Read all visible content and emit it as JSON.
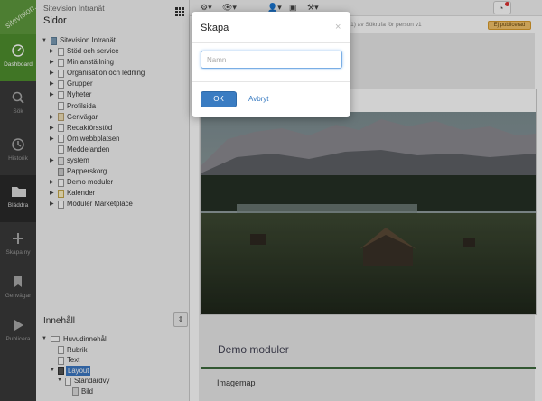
{
  "rail": {
    "logo": "sitevision.",
    "items": [
      {
        "label": "Dashboard",
        "icon": "gauge-icon"
      },
      {
        "label": "Sök",
        "icon": "search-icon"
      },
      {
        "label": "Historik",
        "icon": "history-icon"
      },
      {
        "label": "Bläddra",
        "icon": "folder-icon"
      },
      {
        "label": "Skapa ny",
        "icon": "plus-icon"
      },
      {
        "label": "Genvägar",
        "icon": "bookmark-icon"
      },
      {
        "label": "Publicera",
        "icon": "play-icon"
      }
    ]
  },
  "panel": {
    "site_name": "Sitevision Intranät",
    "section_title": "Sidor",
    "tree": [
      {
        "label": "Sitevision Intranät"
      },
      {
        "label": "Stöd och service"
      },
      {
        "label": "Min anställning"
      },
      {
        "label": "Organisation och ledning"
      },
      {
        "label": "Grupper"
      },
      {
        "label": "Nyheter"
      },
      {
        "label": "Profilsida"
      },
      {
        "label": "Genvägar"
      },
      {
        "label": "Redaktörsstöd"
      },
      {
        "label": "Om webbplatsen"
      },
      {
        "label": "Meddelanden"
      },
      {
        "label": "system"
      },
      {
        "label": "Papperskorg"
      },
      {
        "label": "Demo moduler"
      },
      {
        "label": "Kalender"
      },
      {
        "label": "Moduler Marketplace"
      }
    ],
    "content_title": "Innehåll",
    "content_tree": [
      {
        "label": "Huvudinnehåll"
      },
      {
        "label": "Rubrik"
      },
      {
        "label": "Text"
      },
      {
        "label": "Layout"
      },
      {
        "label": "Standardvy"
      },
      {
        "label": "Bild"
      }
    ]
  },
  "toolbar": {
    "note": "(1) av Sökrufa för person v1",
    "status_badge": "Ej publicerad"
  },
  "page": {
    "section_title": "Demo moduler",
    "image_title": "Imagemap"
  },
  "modal": {
    "title": "Skapa",
    "close": "×",
    "input_placeholder": "Namn",
    "ok_label": "OK",
    "cancel_label": "Avbryt"
  }
}
